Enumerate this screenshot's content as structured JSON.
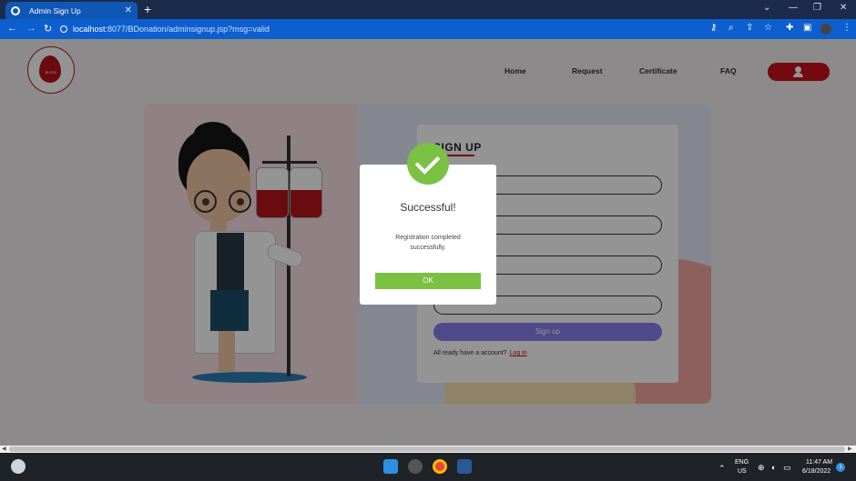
{
  "browser": {
    "tab_title": "Admin Sign Up",
    "tab_close": "✕",
    "new_tab": "+",
    "url_host": "localhost",
    "url_path": ":8077/BDonation/adminsignup.jsp?msg=valid",
    "window_controls": [
      "⌄",
      "—",
      "❐",
      "✕"
    ]
  },
  "site": {
    "nav": [
      "Home",
      "Request",
      "Certificate",
      "FAQ"
    ],
    "logo_text": "BLOOD"
  },
  "form": {
    "title": "SIGN UP",
    "signup_label": "Sign up",
    "login_prompt": "All ready have a account?",
    "login_link": "Log in"
  },
  "modal": {
    "title": "Successful!",
    "message": "Registration completed successfully.",
    "ok_label": "OK"
  },
  "taskbar": {
    "lang_top": "ENG",
    "lang_bottom": "US",
    "time": "11:47 AM",
    "date": "6/18/2022",
    "notification_count": "1"
  },
  "colors": {
    "brand_red": "#c8101a",
    "success_green": "#7ac143",
    "chrome_blue": "#0d5fcf"
  }
}
